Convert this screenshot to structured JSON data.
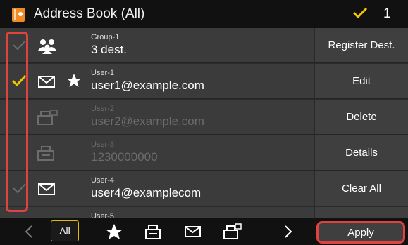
{
  "header": {
    "title": "Address Book (All)",
    "selected_count": "1"
  },
  "entries": [
    {
      "name": "Group-1",
      "detail": "3 dest.",
      "type": "group-icon",
      "checked": false,
      "enabled": true,
      "favorite": false
    },
    {
      "name": "User-1",
      "detail": "user1@example.com",
      "type": "email-icon",
      "checked": true,
      "enabled": true,
      "favorite": true
    },
    {
      "name": "User-2",
      "detail": "user2@example.com",
      "type": "ifax-icon",
      "checked": false,
      "enabled": false,
      "favorite": false
    },
    {
      "name": "User-3",
      "detail": "1230000000",
      "type": "fax-icon",
      "checked": false,
      "enabled": false,
      "favorite": false
    },
    {
      "name": "User-4",
      "detail": "user4@examplecom",
      "type": "email-icon",
      "checked": false,
      "enabled": true,
      "favorite": false
    },
    {
      "name": "User-5",
      "detail": "",
      "type": "",
      "checked": false,
      "enabled": true,
      "favorite": false
    }
  ],
  "side_buttons": [
    "Register Dest.",
    "Edit",
    "Delete",
    "Details",
    "Clear All"
  ],
  "bottom": {
    "prev": "prev-arrow-icon",
    "all_label": "All",
    "next": "next-arrow-icon",
    "apply_label": "Apply"
  },
  "colors": {
    "accent": "#f5c400",
    "highlight": "#e0423f",
    "title_bg": "#111111",
    "row_bg": "#3b3b3b"
  }
}
